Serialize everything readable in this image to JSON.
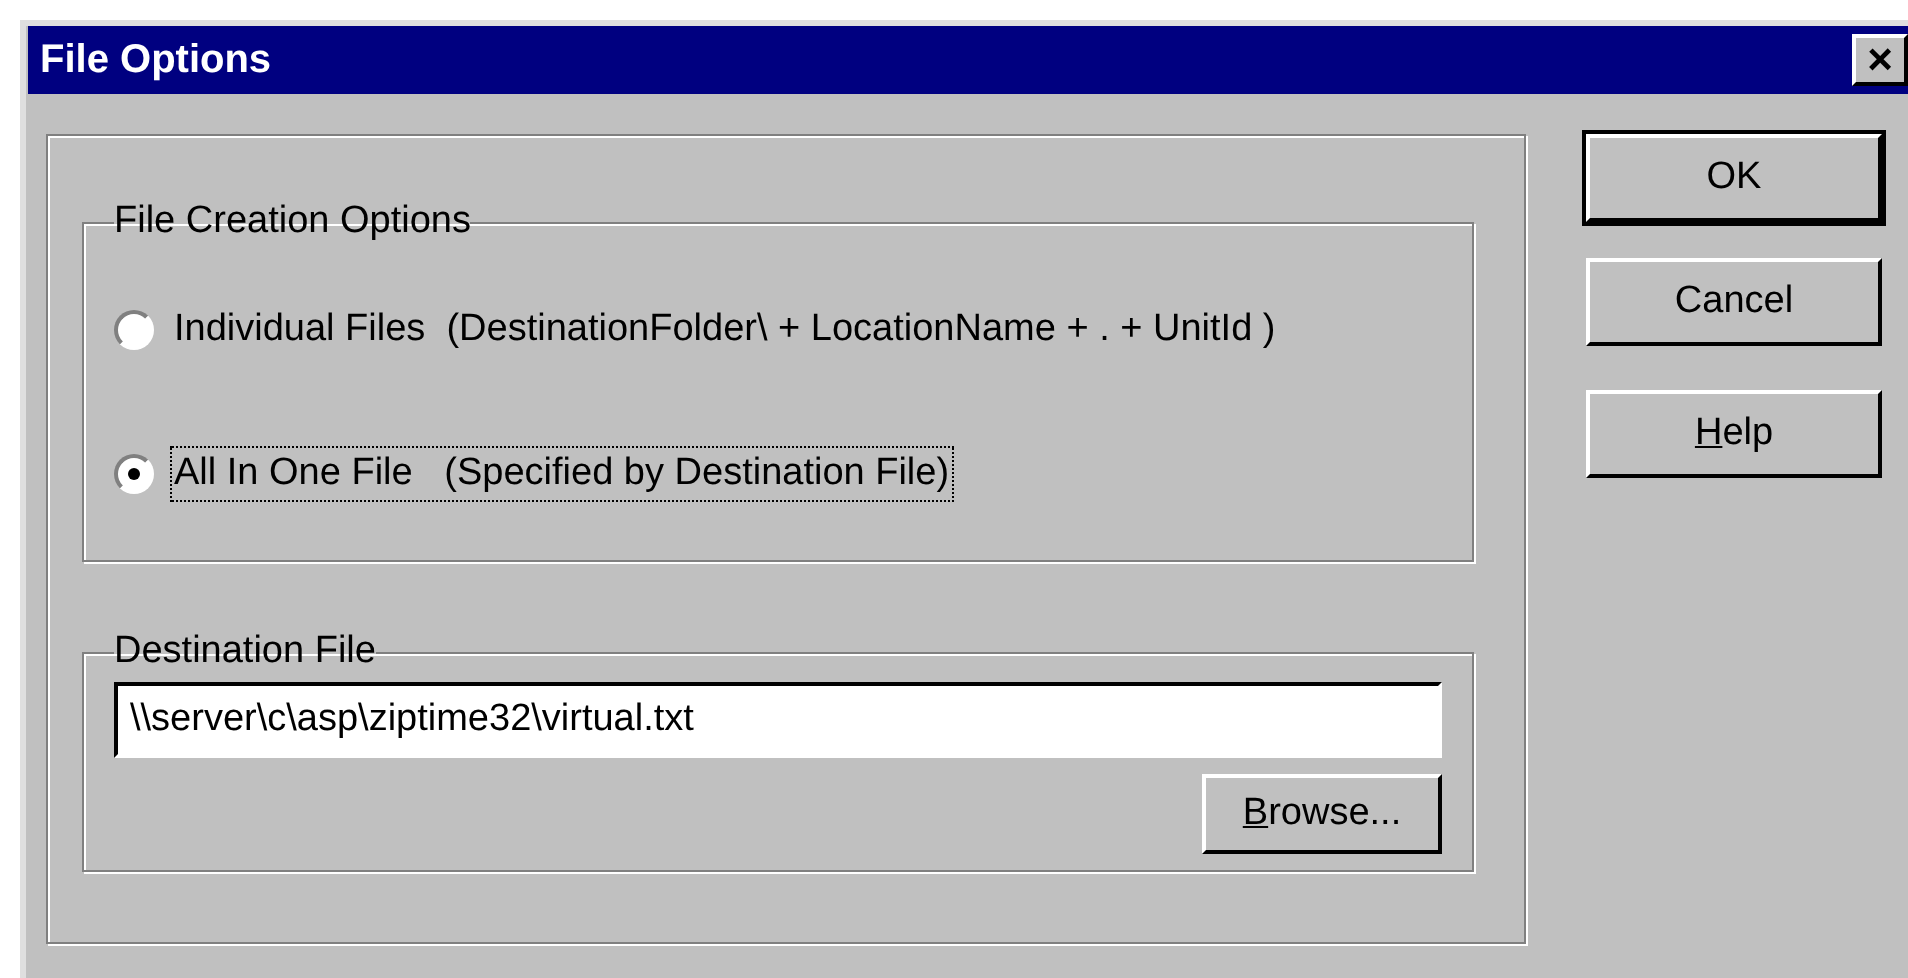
{
  "window": {
    "title": "File Options",
    "close": "×"
  },
  "creation_group": {
    "title": "File Creation Options",
    "options": [
      {
        "label": "Individual Files  (DestinationFolder\\ + LocationName + . + UnitId )",
        "selected": false,
        "focused": false
      },
      {
        "label": "All In One File   (Specified by Destination File)",
        "selected": true,
        "focused": true
      }
    ]
  },
  "destination_group": {
    "title": "Destination File",
    "value": "\\\\server\\c\\asp\\ziptime32\\virtual.txt",
    "browse": {
      "label": "Browse...",
      "mnemonic": true
    }
  },
  "buttons": [
    {
      "label": "OK",
      "default": true,
      "mnemonic": false
    },
    {
      "label": "Cancel",
      "default": false,
      "mnemonic": false
    },
    {
      "label": "Help",
      "default": false,
      "mnemonic": true
    }
  ]
}
